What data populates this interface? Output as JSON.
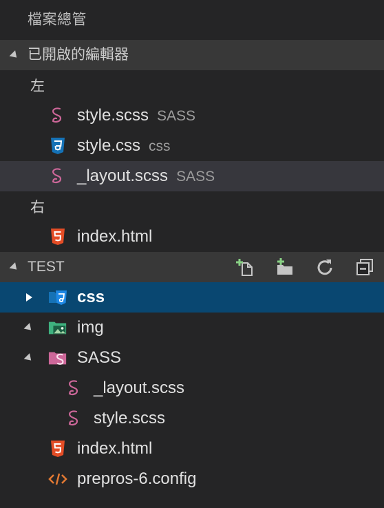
{
  "panel": {
    "title": "檔案總管"
  },
  "open_editors": {
    "header": "已開啟的編輯器",
    "groups": [
      {
        "label": "左",
        "files": [
          {
            "name": "style.scss",
            "description": "SASS",
            "icon": "sass-icon"
          },
          {
            "name": "style.css",
            "description": "css",
            "icon": "css3-icon"
          },
          {
            "name": "_layout.scss",
            "description": "SASS",
            "icon": "sass-icon"
          }
        ]
      },
      {
        "label": "右",
        "files": [
          {
            "name": "index.html",
            "icon": "html5-icon"
          }
        ]
      }
    ]
  },
  "test": {
    "header": "TEST",
    "actions": [
      "new-file-icon",
      "new-folder-icon",
      "refresh-icon",
      "collapse-all-icon"
    ],
    "tree": [
      {
        "name": "css",
        "type": "folder",
        "expanded": false,
        "icon": "css-folder-icon"
      },
      {
        "name": "img",
        "type": "folder",
        "expanded": true,
        "icon": "image-folder-icon"
      },
      {
        "name": "SASS",
        "type": "folder",
        "expanded": true,
        "icon": "sass-folder-icon"
      },
      {
        "name": "_layout.scss",
        "type": "file",
        "icon": "sass-icon"
      },
      {
        "name": "style.scss",
        "type": "file",
        "icon": "sass-icon"
      },
      {
        "name": "index.html",
        "type": "file",
        "icon": "html5-icon"
      },
      {
        "name": "prepros-6.config",
        "type": "file",
        "icon": "code-icon"
      }
    ]
  },
  "colors": {
    "background": "#252526",
    "header_bg": "#383838",
    "selected_bg": "#094771",
    "hover_bg": "#37373d",
    "sass_pink": "#cd6799",
    "css_blue": "#1572b6",
    "html_orange": "#e44d26",
    "folder_green": "#3fb27f",
    "config_orange": "#e37933"
  }
}
